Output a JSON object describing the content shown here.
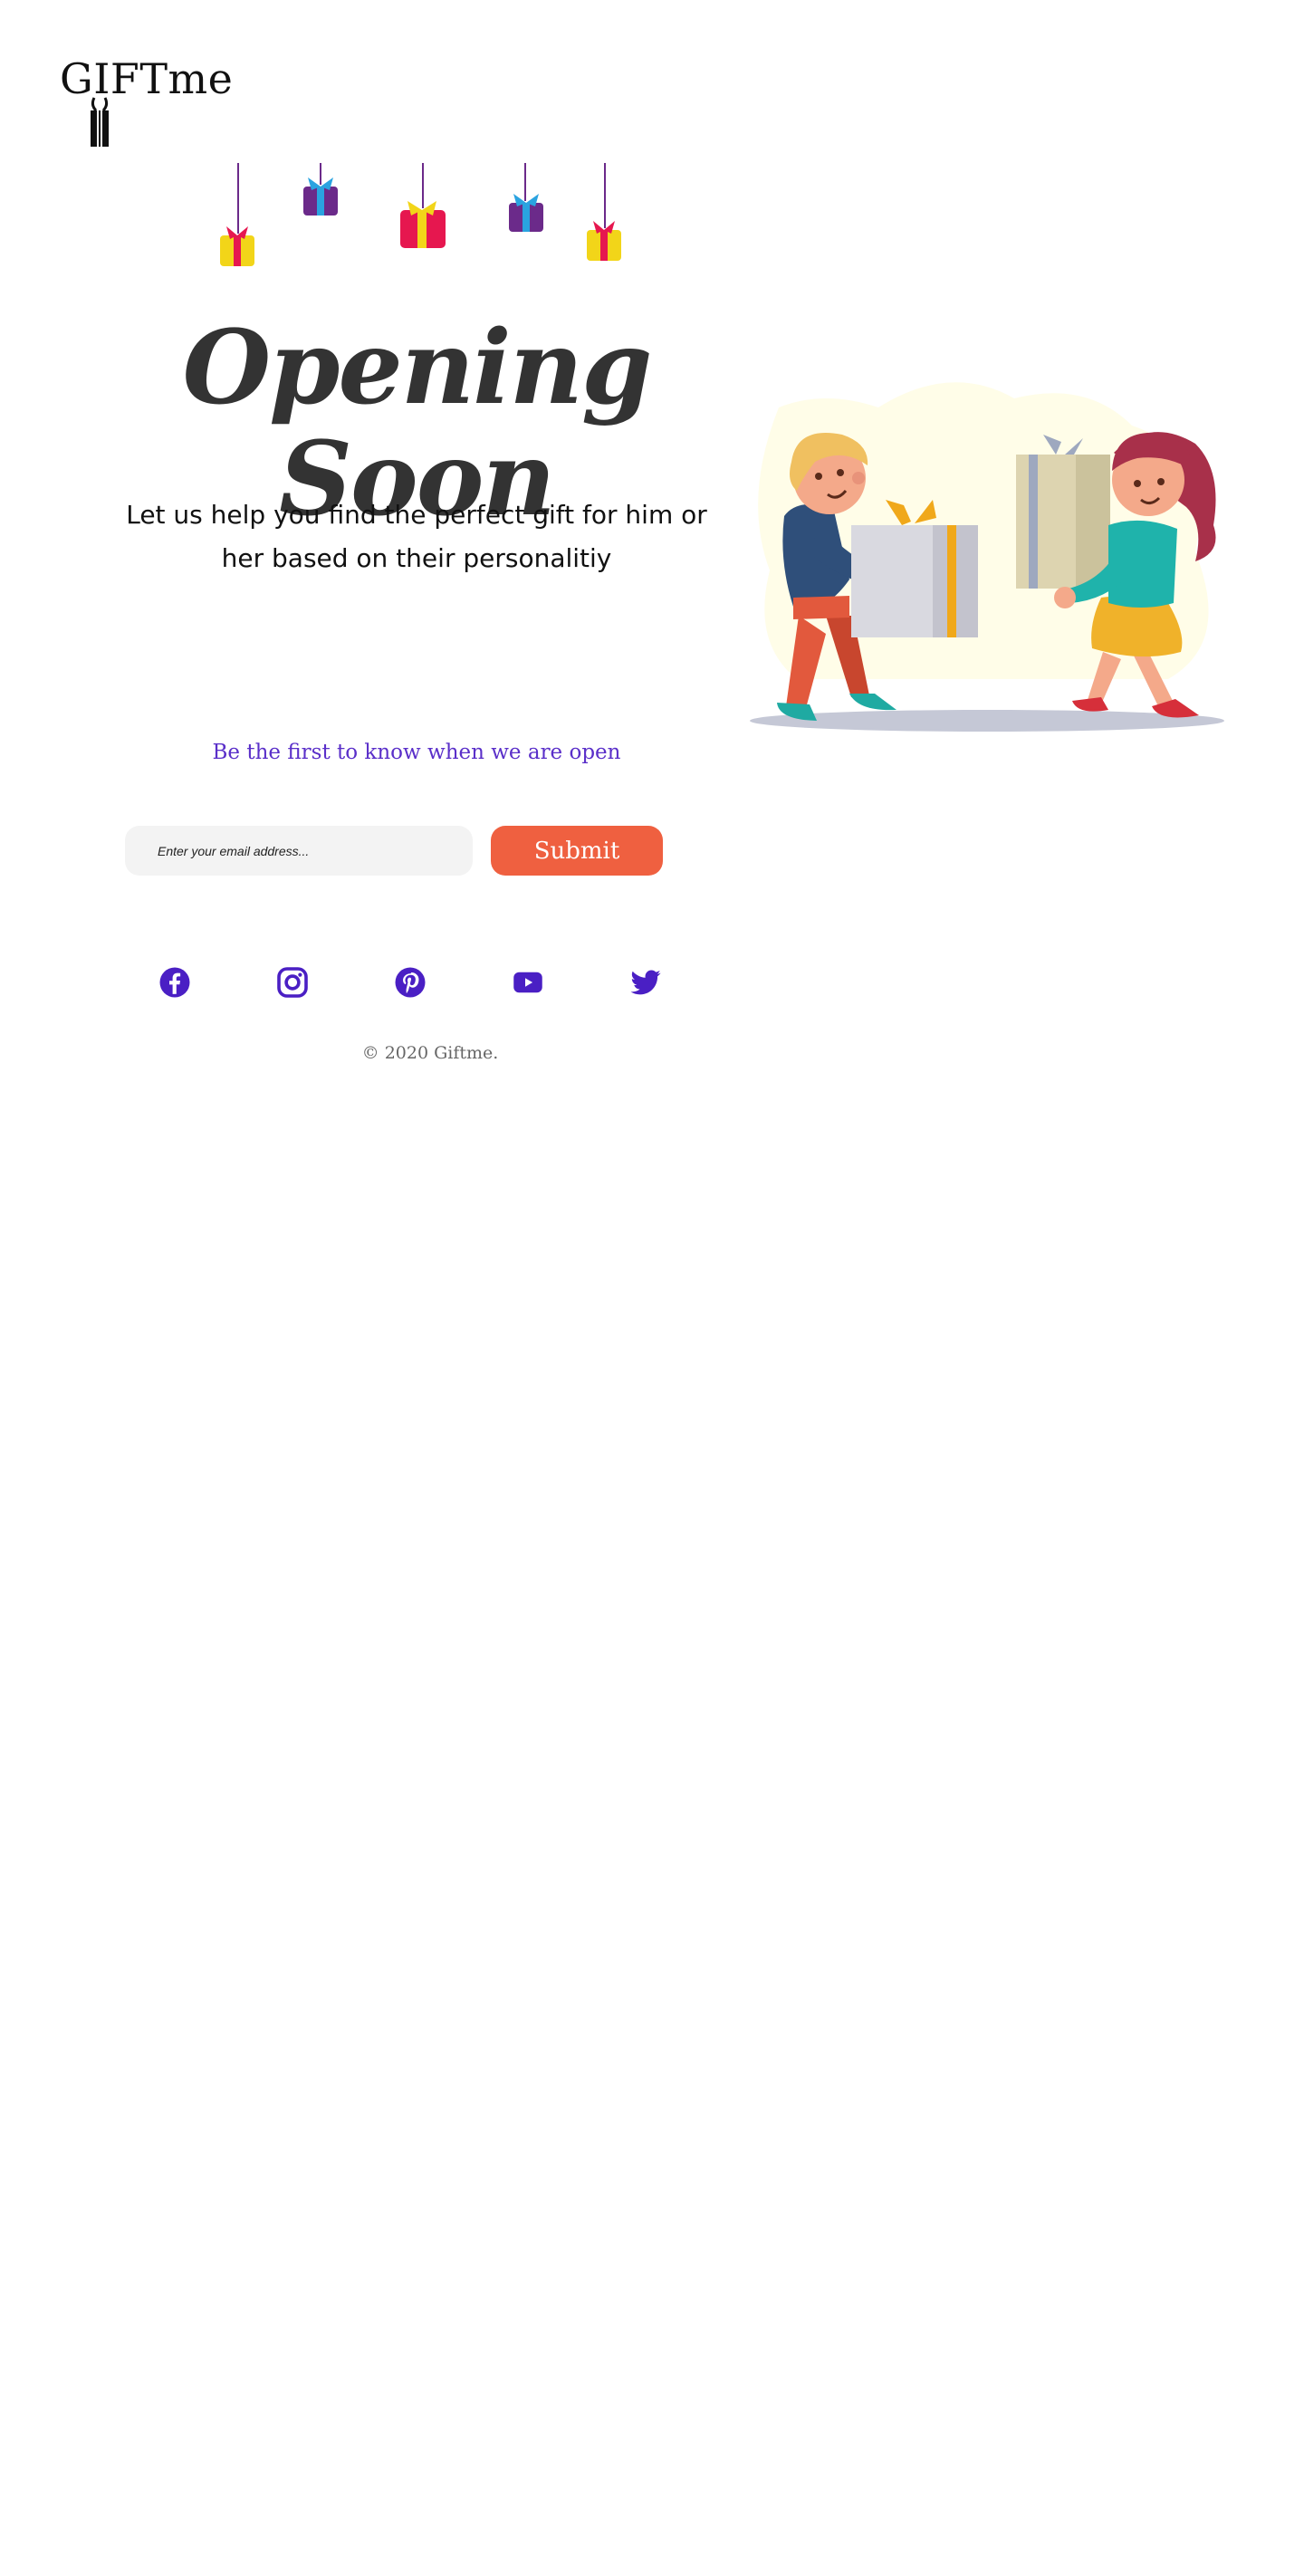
{
  "brand": {
    "name": "GIFTme"
  },
  "hero": {
    "title": "Opening Soon",
    "subtitle": "Let us help you find the perfect gift for him or her based on their personalitiy"
  },
  "notify": {
    "text": "Be the first to know when we are open"
  },
  "form": {
    "email_placeholder": "Enter your email address...",
    "submit_label": "Submit"
  },
  "social": {
    "items": [
      {
        "name": "facebook-icon"
      },
      {
        "name": "instagram-icon"
      },
      {
        "name": "pinterest-icon"
      },
      {
        "name": "youtube-icon"
      },
      {
        "name": "twitter-icon"
      }
    ],
    "color": "#4a1fc4"
  },
  "footer": {
    "copyright": "© 2020 Giftme."
  },
  "colors": {
    "accent_button": "#ef6040",
    "notify_text": "#5a2fc9",
    "heading": "#333333"
  }
}
